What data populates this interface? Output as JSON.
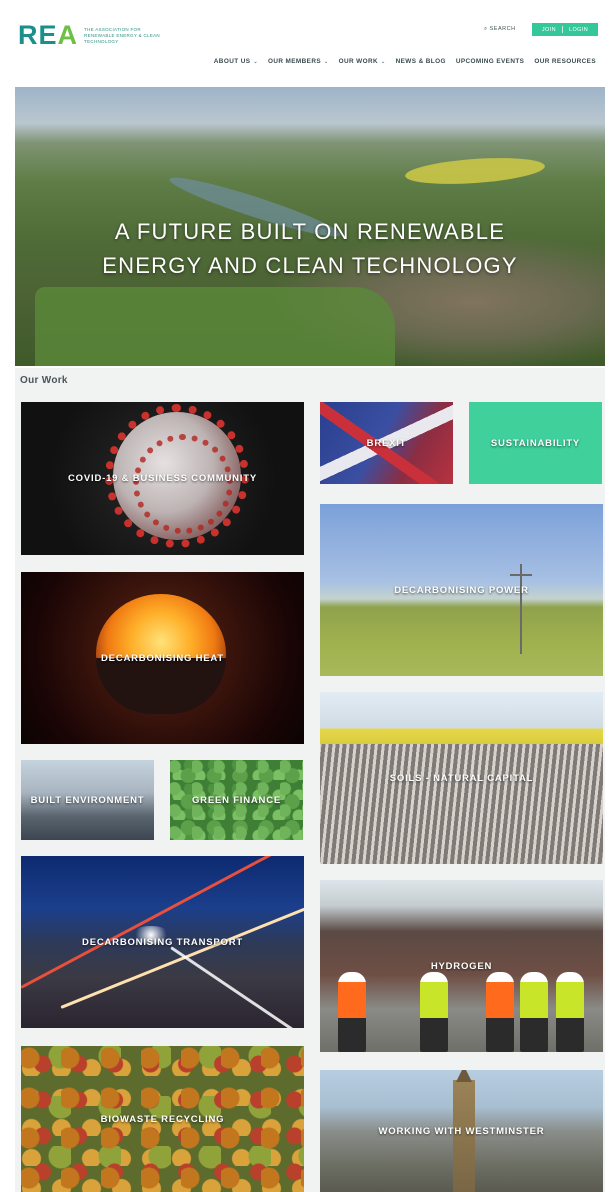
{
  "header": {
    "logo_text_main": "RE",
    "logo_text_accent": "A",
    "logo_tagline": "The Association for Renewable Energy & Clean Technology",
    "search_label": "SEARCH",
    "join_label": "JOIN",
    "login_label": "LOGIN",
    "nav": [
      {
        "label": "ABOUT US",
        "has_dropdown": true
      },
      {
        "label": "OUR MEMBERS",
        "has_dropdown": true
      },
      {
        "label": "OUR WORK",
        "has_dropdown": true
      },
      {
        "label": "NEWS & BLOG",
        "has_dropdown": false
      },
      {
        "label": "UPCOMING EVENTS",
        "has_dropdown": false
      },
      {
        "label": "OUR RESOURCES",
        "has_dropdown": false
      }
    ],
    "accent_color": "#33c79a"
  },
  "hero": {
    "title_line1": "A FUTURE BUILT ON RENEWABLE",
    "title_line2": "ENERGY AND CLEAN TECHNOLOGY"
  },
  "our_work": {
    "heading": "Our Work",
    "tiles": [
      {
        "label": "COVID-19 & BUSINESS COMMUNITY"
      },
      {
        "label": "BREXIT"
      },
      {
        "label": "SUSTAINABILITY",
        "color": "#3fd09b"
      },
      {
        "label": "DECARBONISING POWER"
      },
      {
        "label": "DECARBONISING HEAT"
      },
      {
        "label": "SOILS - NATURAL CAPITAL"
      },
      {
        "label": "BUILT ENVIRONMENT"
      },
      {
        "label": "GREEN FINANCE"
      },
      {
        "label": "DECARBONISING TRANSPORT"
      },
      {
        "label": "HYDROGEN"
      },
      {
        "label": "BIOWASTE RECYCLING"
      },
      {
        "label": "WORKING WITH WESTMINSTER"
      }
    ]
  }
}
